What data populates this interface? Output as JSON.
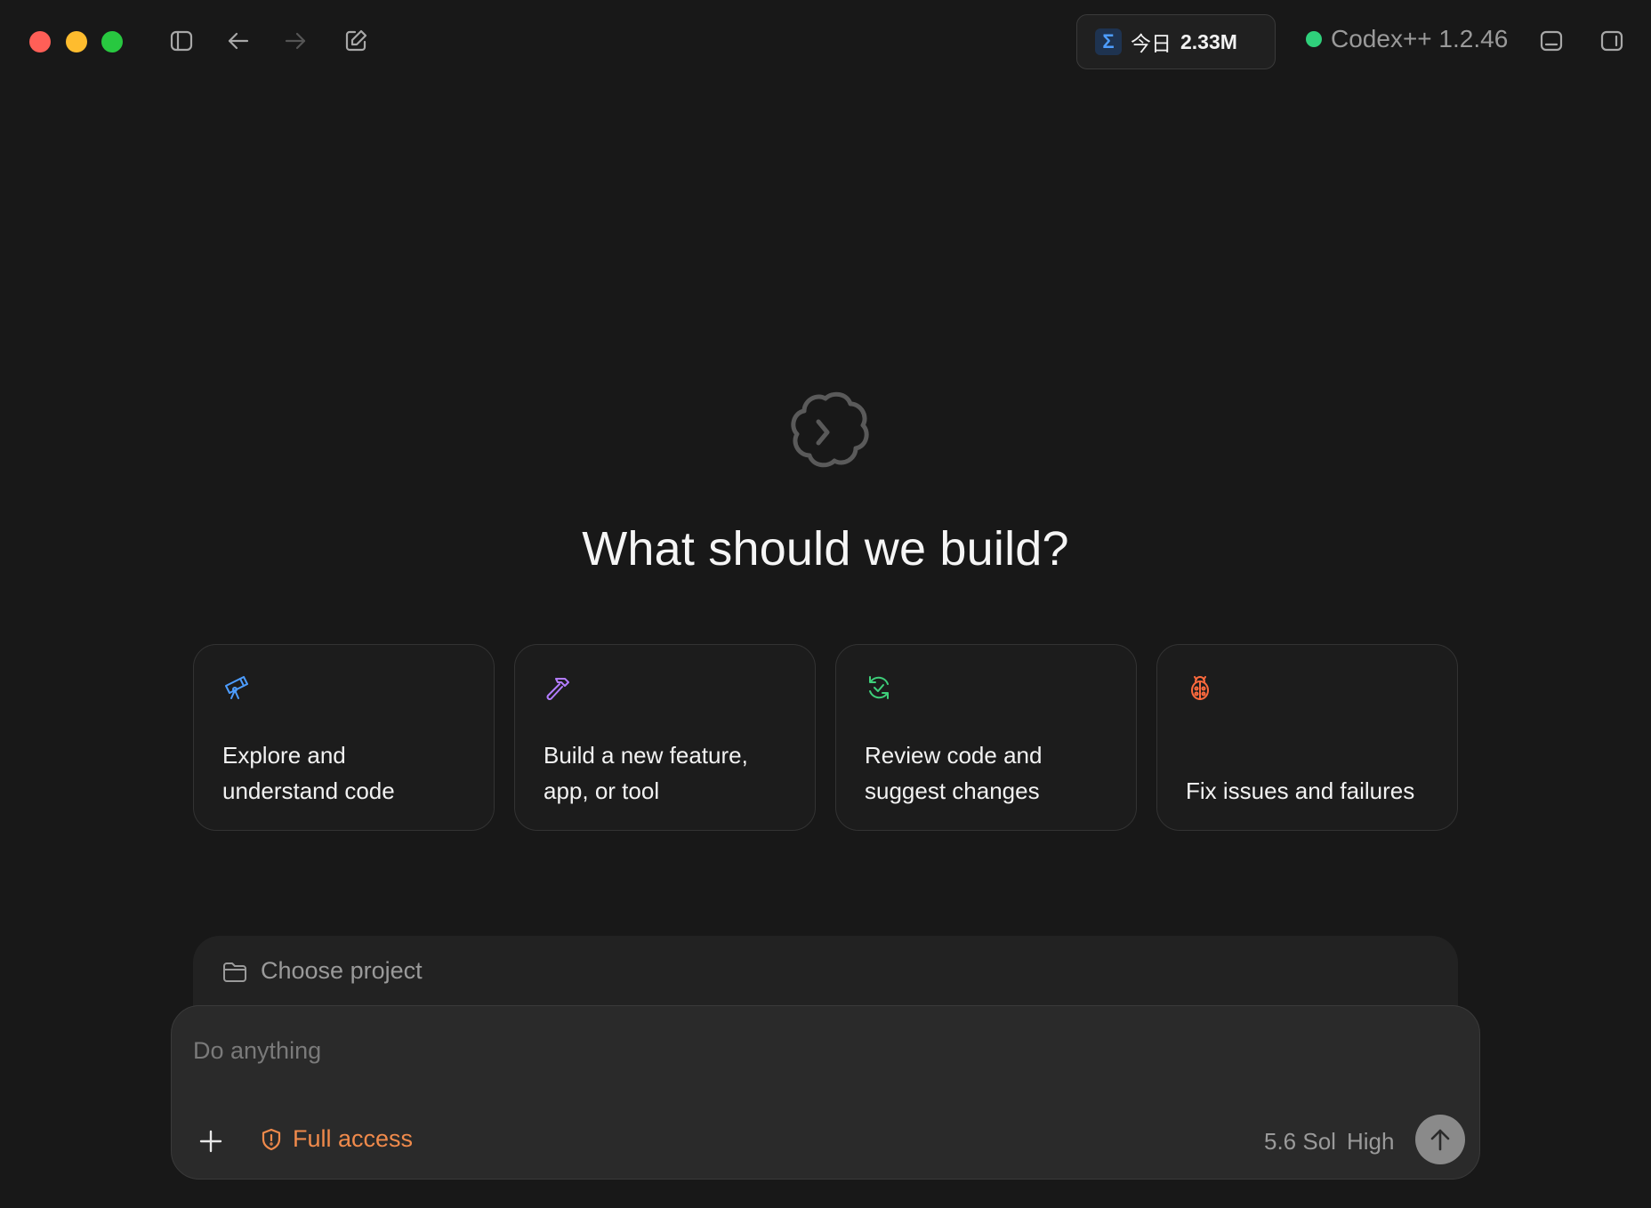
{
  "titlebar": {
    "usage": {
      "today_label": "今日",
      "value": "2.33M",
      "sigma": "Σ"
    },
    "status": {
      "label": "Codex++ 1.2.46",
      "dot_color": "#2fd07b"
    },
    "icons": [
      "sidebar-toggle-icon",
      "back-arrow-icon",
      "forward-arrow-icon",
      "new-chat-icon",
      "bottom-panel-icon",
      "right-panel-icon"
    ]
  },
  "hero": {
    "title": "What should we build?"
  },
  "cards": [
    {
      "label": "Explore and\nunderstand code",
      "icon": "telescope-icon",
      "color": "#4d9dff"
    },
    {
      "label": "Build a new feature,\napp, or tool",
      "icon": "hammer-icon",
      "color": "#b37cff"
    },
    {
      "label": "Review code and\nsuggest changes",
      "icon": "refresh-check-icon",
      "color": "#3ecf7a"
    },
    {
      "label": "Fix issues and failures",
      "icon": "bug-icon",
      "color": "#ff6a3d"
    }
  ],
  "project": {
    "label": "Choose project"
  },
  "composer": {
    "placeholder": "Do anything",
    "access_label": "Full access",
    "access_color": "#f08a4b",
    "model": "5.6 Sol",
    "effort": "High"
  }
}
